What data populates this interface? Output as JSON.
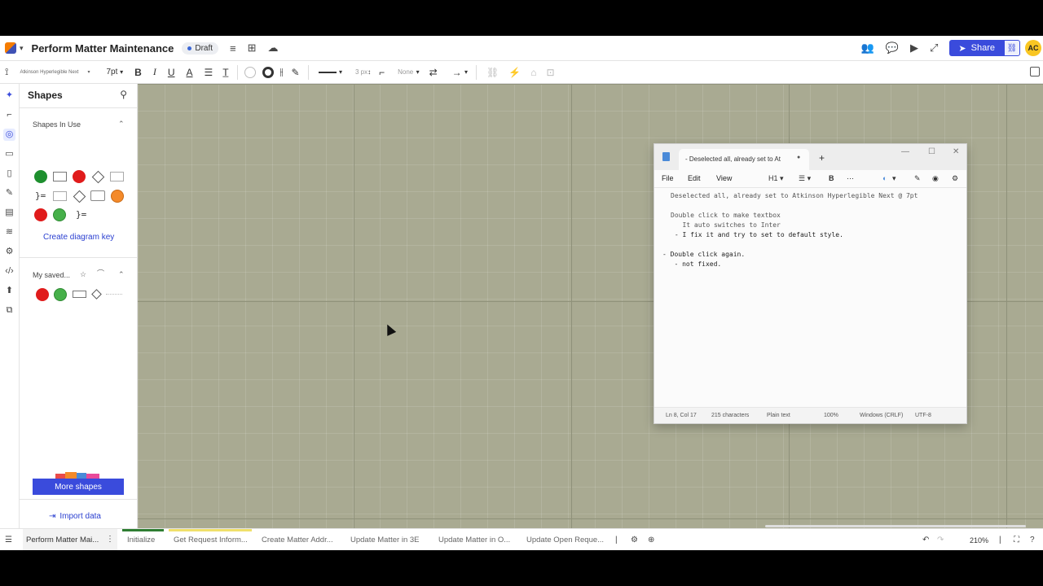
{
  "header": {
    "doc_title": "Perform Matter Maintenance",
    "status": "Draft",
    "share_label": "Share",
    "avatar_initials": "AC"
  },
  "toolbar": {
    "font_family": "Atkinson Hyperlegible Next",
    "font_size": "7pt",
    "bold": "B",
    "italic": "I",
    "underline": "U",
    "text_color": "A",
    "line_width": "3 px",
    "line_style": "None"
  },
  "shapes_panel": {
    "title": "Shapes",
    "in_use_title": "Shapes In Use",
    "create_key": "Create diagram key",
    "saved_title": "My saved...",
    "more_shapes": "More shapes",
    "import_data": "Import data"
  },
  "notepad": {
    "tab_title": "- Deselected all, already set to At",
    "menu": [
      "File",
      "Edit",
      "View"
    ],
    "heading_selector": "H1",
    "lines": [
      "Deselected all, already set to Atkinson Hyperlegible Next @ 7pt",
      "",
      "Double click to make textbox",
      "   It auto switches to Inter",
      " - I fix it and try to set to default style.",
      "",
      "- Double click again.",
      "   - not fixed."
    ],
    "status": {
      "position": "Ln 8, Col 17",
      "chars": "215 characters",
      "format": "Plain text",
      "zoom": "100%",
      "eol": "Windows (CRLF)",
      "encoding": "UTF-8"
    }
  },
  "pages": [
    {
      "label": "Perform Matter Mai...",
      "color": ""
    },
    {
      "label": "Initialize",
      "color": "#2e7d32"
    },
    {
      "label": "Get Request Inform...",
      "color": "#f0e06a"
    },
    {
      "label": "Create Matter Addr...",
      "color": ""
    },
    {
      "label": "Update Matter in 3E",
      "color": ""
    },
    {
      "label": "Update Matter in O...",
      "color": ""
    },
    {
      "label": "Update Open Reque...",
      "color": ""
    }
  ],
  "zoom_level": "210%",
  "colors": {
    "accent": "#3a4bdc",
    "canvas": "#a9aa92"
  }
}
